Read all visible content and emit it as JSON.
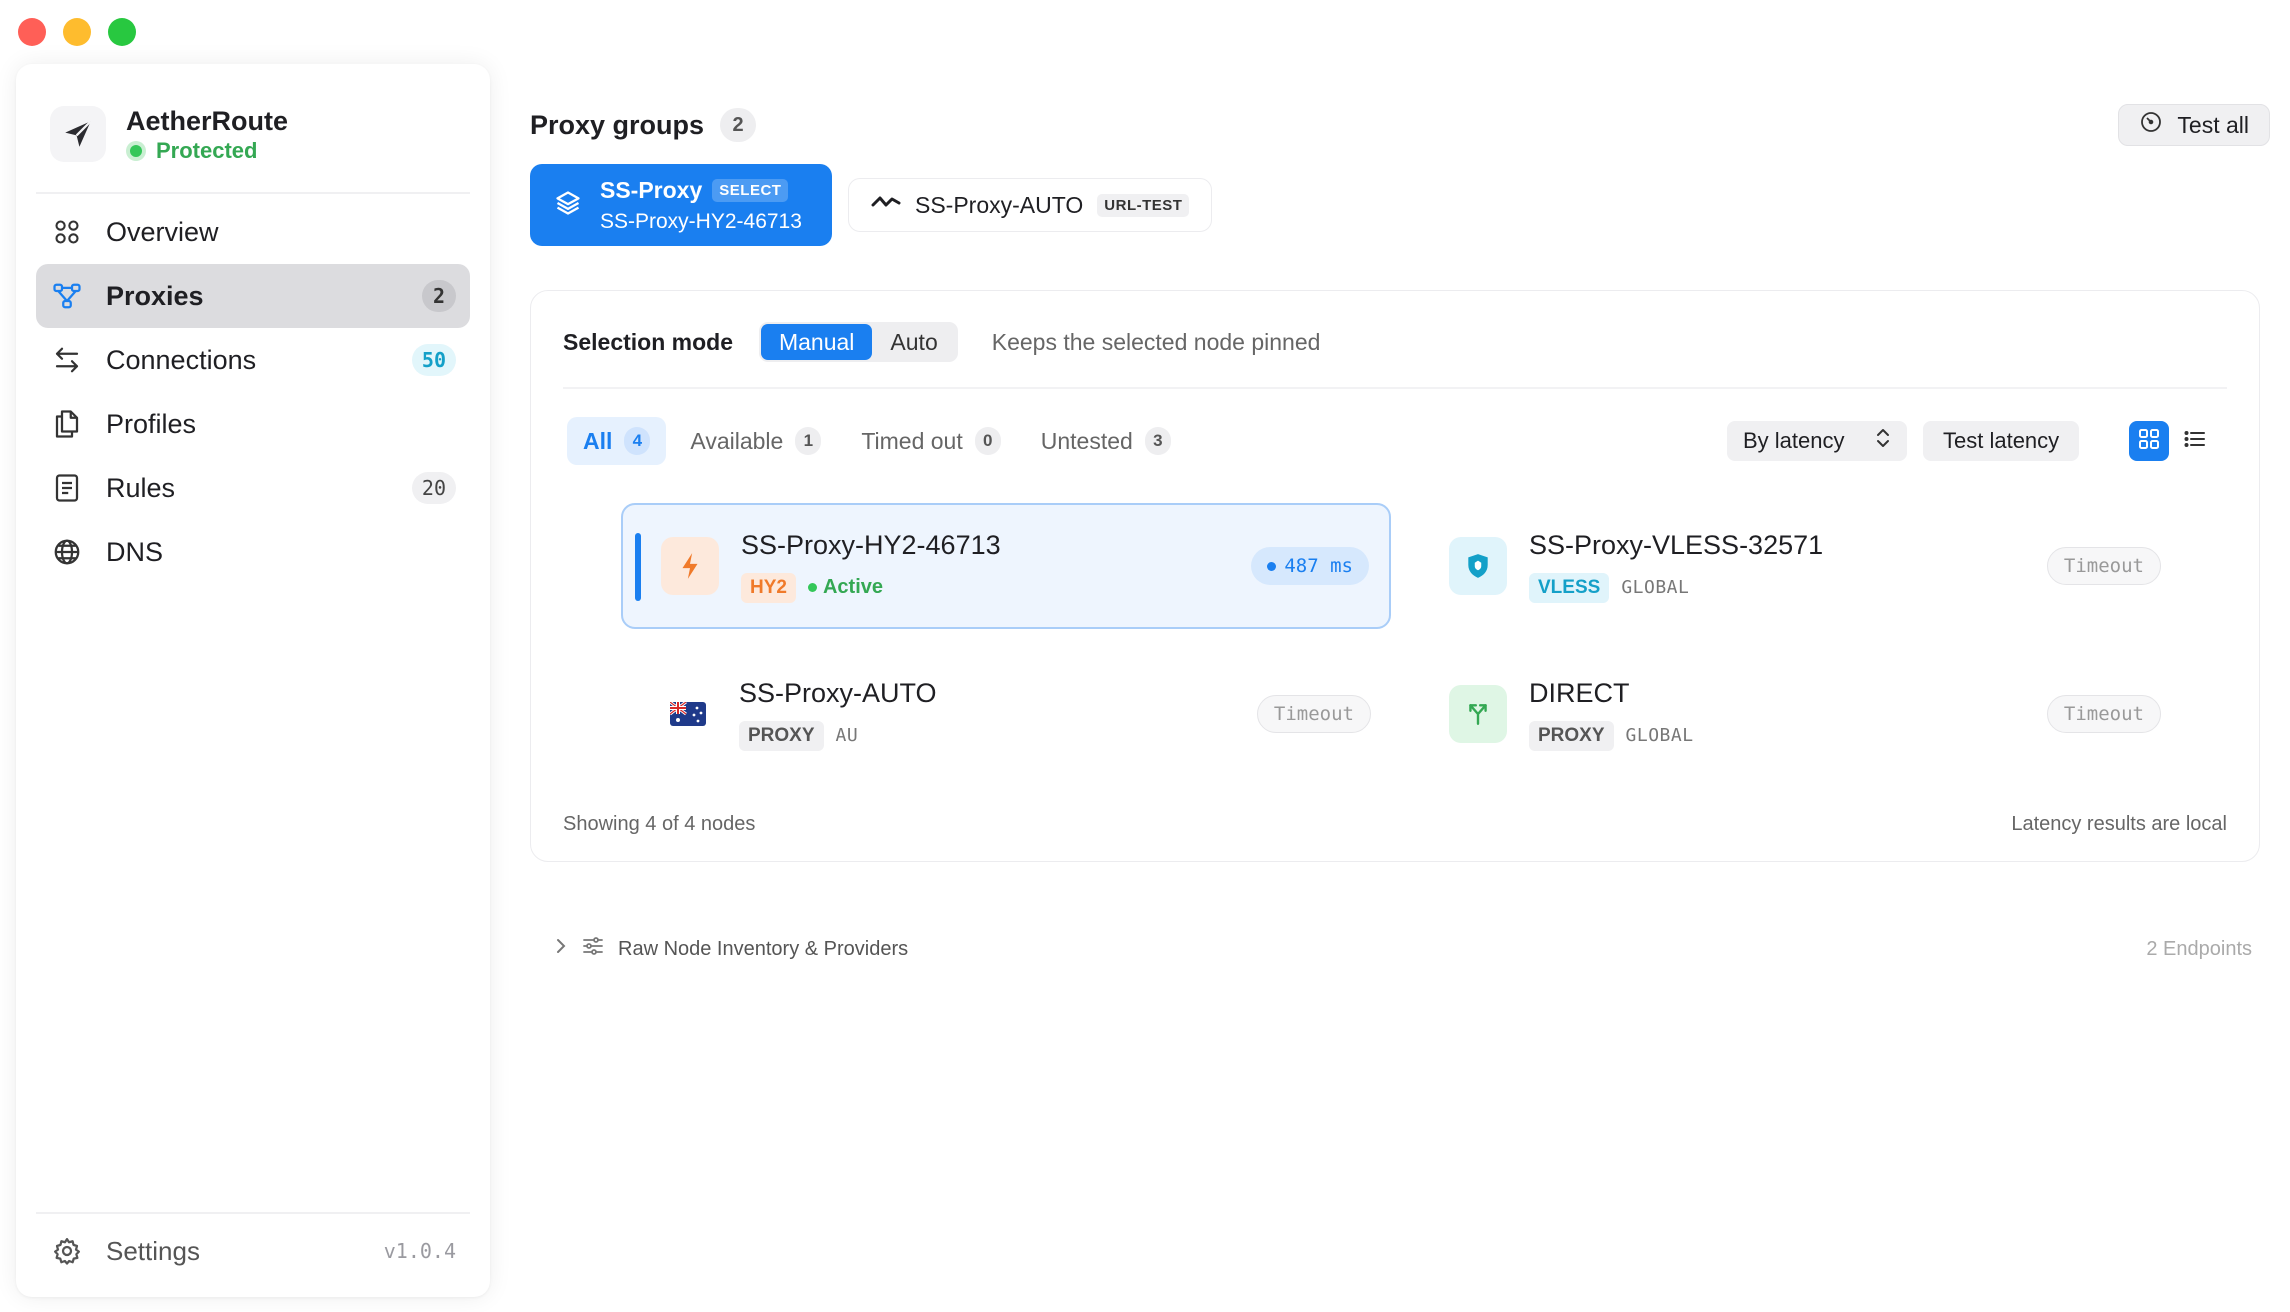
{
  "app": {
    "name": "AetherRoute",
    "status": "Protected",
    "version": "v1.0.4"
  },
  "colors": {
    "accent": "#1a7ff0",
    "success": "#34c759",
    "cyan": "#14a0c8",
    "orange": "#f07a2a"
  },
  "sidebar": {
    "items": [
      {
        "label": "Overview",
        "icon": "grid-icon",
        "count": ""
      },
      {
        "label": "Proxies",
        "icon": "network-icon",
        "count": "2"
      },
      {
        "label": "Connections",
        "icon": "arrows-icon",
        "count": "50"
      },
      {
        "label": "Profiles",
        "icon": "documents-icon",
        "count": ""
      },
      {
        "label": "Rules",
        "icon": "list-doc-icon",
        "count": "20"
      },
      {
        "label": "DNS",
        "icon": "globe-icon",
        "count": ""
      }
    ],
    "settings_label": "Settings"
  },
  "main": {
    "groups_title": "Proxy groups",
    "groups_count": "2",
    "test_all_label": "Test all",
    "groups": [
      {
        "name": "SS-Proxy",
        "type": "SELECT",
        "selected": "SS-Proxy-HY2-46713"
      },
      {
        "name": "SS-Proxy-AUTO",
        "type": "URL-TEST"
      }
    ],
    "selection": {
      "label": "Selection mode",
      "options": [
        "Manual",
        "Auto"
      ],
      "active": "Manual",
      "hint": "Keeps the selected node pinned"
    },
    "filters": [
      {
        "label": "All",
        "count": "4"
      },
      {
        "label": "Available",
        "count": "1"
      },
      {
        "label": "Timed out",
        "count": "0"
      },
      {
        "label": "Untested",
        "count": "3"
      }
    ],
    "sort_label": "By latency",
    "test_latency_label": "Test latency",
    "nodes": [
      {
        "name": "SS-Proxy-HY2-46713",
        "tag": "HY2",
        "status": "Active",
        "latency": "487 ms"
      },
      {
        "name": "SS-Proxy-VLESS-32571",
        "tag": "VLESS",
        "region": "GLOBAL",
        "latency": "Timeout"
      },
      {
        "name": "SS-Proxy-AUTO",
        "tag": "PROXY",
        "region": "AU",
        "latency": "Timeout"
      },
      {
        "name": "DIRECT",
        "tag": "PROXY",
        "region": "GLOBAL",
        "latency": "Timeout"
      }
    ],
    "footer_left": "Showing 4 of 4 nodes",
    "footer_right": "Latency results are local",
    "raw_label": "Raw Node Inventory & Providers",
    "raw_count": "2 Endpoints"
  }
}
